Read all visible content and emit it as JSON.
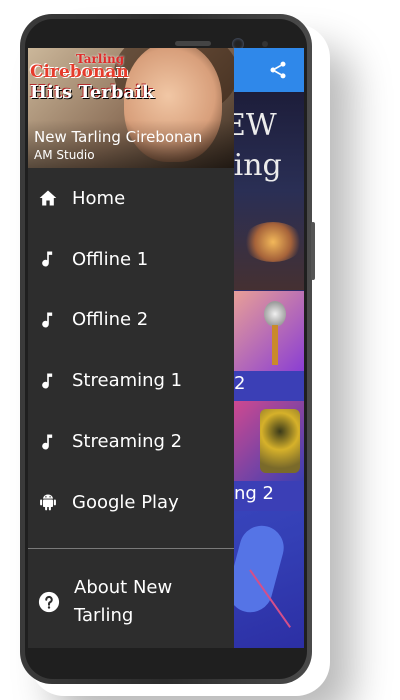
{
  "app": {
    "header_title": "New Tarling Cirebonan",
    "header_subtitle": "AM Studio",
    "logo_text_top": "Tarling",
    "logo_text_line1": "Cirebonan",
    "logo_text_line2": "Hits Terbaik"
  },
  "drawer": {
    "items": [
      {
        "label": "Home",
        "icon": "home-icon"
      },
      {
        "label": "Offline 1",
        "icon": "music-note-icon"
      },
      {
        "label": "Offline 2",
        "icon": "music-note-icon"
      },
      {
        "label": "Streaming 1",
        "icon": "music-note-icon"
      },
      {
        "label": "Streaming 2",
        "icon": "music-note-icon"
      },
      {
        "label": "Google Play",
        "icon": "android-icon"
      }
    ],
    "about_label": "About New Tarling"
  },
  "background": {
    "banner_text_line1": "EW",
    "banner_text_line2": "ling",
    "tile1_label": "2",
    "tile2_label": "ng 2"
  },
  "colors": {
    "app_bar": "#2f88ea",
    "drawer_bg": "#2d2d2d",
    "accent_blue": "#3b3fb6"
  }
}
